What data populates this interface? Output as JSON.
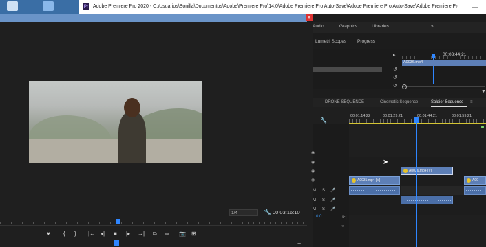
{
  "window": {
    "title": "Adobe Premiere Pro 2020 - C:\\Usuarios\\Bonilla\\Documentos\\Adobe\\Premiere Pro\\14.0\\Adobe Premiere Pro Auto-Save\\Adobe Premiere Pro Auto-Save\\Adobe Premiere Pro Auto-Save\\Salto Del ...",
    "app_logo": "Pr",
    "minimize": "—",
    "close": "×"
  },
  "workspace_tabs": [
    "Audio",
    "Graphics",
    "Libraries"
  ],
  "workspace_more": "»",
  "panel_tabs": [
    "Lumetri Scopes",
    "Progress"
  ],
  "source": {
    "timecode": "00:03:44:21",
    "clip_name": "A0036.mp4"
  },
  "monitor": {
    "scale": "1/4",
    "timecode": "00:03:16:10",
    "transport": [
      "♥",
      "{",
      "}",
      "|←",
      "◂|",
      "■",
      "|▸",
      "→|",
      "⧉",
      "⧈",
      "📷",
      "⊞"
    ]
  },
  "timeline": {
    "tabs": [
      {
        "label": "DRONE SEQUENCE",
        "active": false
      },
      {
        "label": "Cinematic Sequence",
        "active": false
      },
      {
        "label": "Soldier Sequence",
        "active": true
      }
    ],
    "menu_icon": "≡",
    "time_labels": [
      "00:01:14:22",
      "00:01:29:21",
      "00:01:44:21",
      "00:01:59:21"
    ],
    "clips": {
      "v1": "A0031.mp4 [V]",
      "v2": "A0036.mp4 [V]",
      "v3": "A00"
    },
    "track_controls": {
      "mute": "M",
      "solo": "S",
      "mic": "🎤"
    },
    "master_level": "0.0"
  },
  "colors": {
    "accent": "#2f86ff",
    "clip_video": "#5d7fb7",
    "clip_audio": "#4b6fa8",
    "work_area": "#d4c534"
  }
}
